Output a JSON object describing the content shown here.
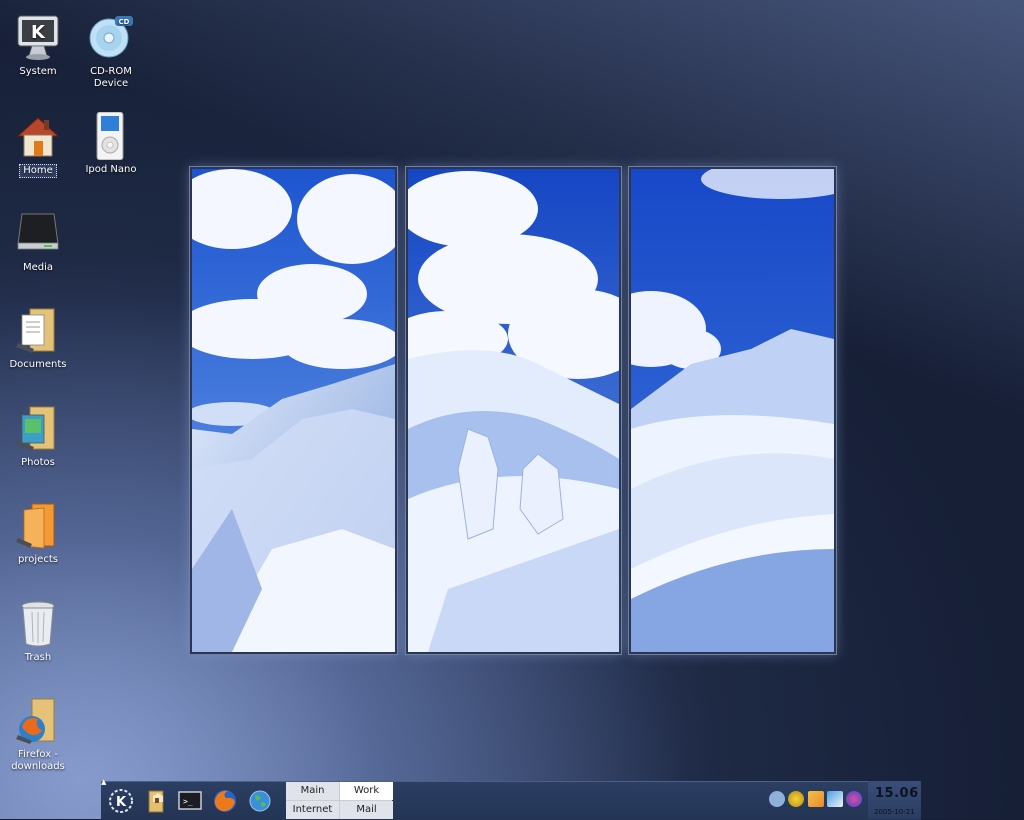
{
  "desktop": {
    "icons": [
      {
        "label": "System",
        "icon": "system-monitor-icon"
      },
      {
        "label": "CD-ROM Device",
        "icon": "cdrom-icon"
      },
      {
        "label": "Home",
        "icon": "home-icon",
        "selected": true
      },
      {
        "label": "Ipod Nano",
        "icon": "ipod-icon"
      },
      {
        "label": "Media",
        "icon": "media-drive-icon"
      },
      {
        "label": "Documents",
        "icon": "documents-folder-icon"
      },
      {
        "label": "Photos",
        "icon": "photos-folder-icon"
      },
      {
        "label": "projects",
        "icon": "projects-folder-icon"
      },
      {
        "label": "Trash",
        "icon": "trash-icon"
      },
      {
        "label": "Firefox - downloads",
        "icon": "firefox-downloads-folder-icon"
      }
    ],
    "cd_badge": "CD"
  },
  "taskbar": {
    "launchers": [
      "kde-menu-icon",
      "file-manager-icon",
      "terminal-icon",
      "firefox-icon",
      "browser-globe-icon"
    ],
    "pager": {
      "desktops": [
        "Main",
        "Work",
        "Internet",
        "Mail"
      ],
      "active": "Work"
    },
    "tray": [
      "volume-icon",
      "update-notifier-icon",
      "klipper-icon",
      "network-icon",
      "kmix-icon"
    ],
    "clock": {
      "time": "15.06",
      "date": "2005-10-21"
    }
  },
  "colors": {
    "sky": "#2a62d8",
    "snow": "#eef3ff",
    "taskbar": "#27385a"
  }
}
